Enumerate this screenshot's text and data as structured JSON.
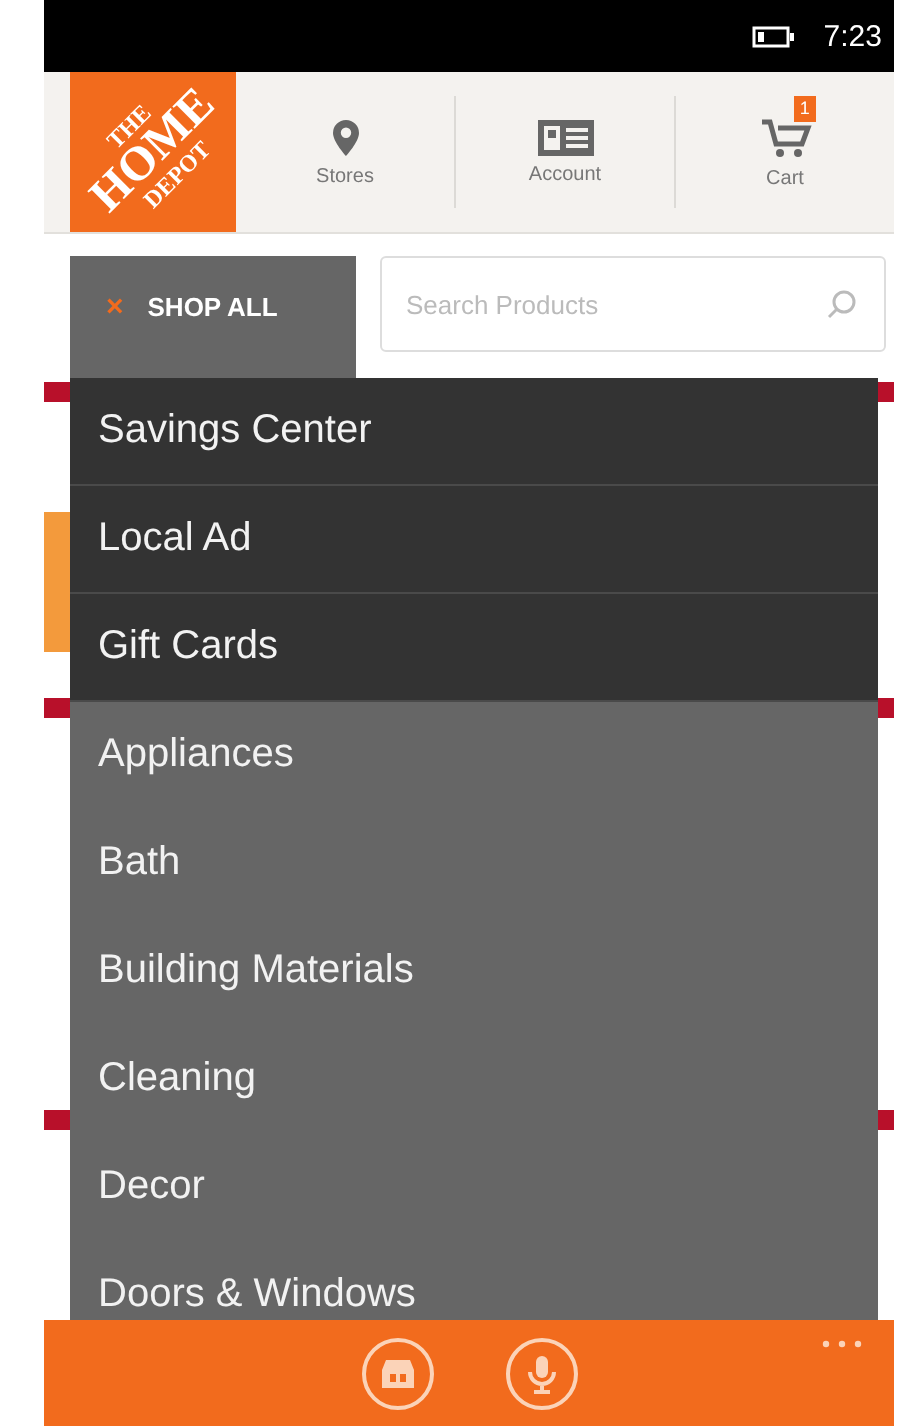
{
  "status_bar": {
    "time": "7:23"
  },
  "logo": [
    "THE",
    "HOME",
    "DEPOT"
  ],
  "nav": [
    {
      "kind": "stores",
      "label": "Stores"
    },
    {
      "kind": "account",
      "label": "Account"
    },
    {
      "kind": "cart",
      "label": "Cart",
      "badge": "1"
    }
  ],
  "shop_all": {
    "label": "SHOP ALL",
    "close": "×",
    "expanded": true
  },
  "search": {
    "placeholder": "Search Products"
  },
  "menu": [
    {
      "label": "Savings Center",
      "kind": "featured"
    },
    {
      "label": "Local Ad",
      "kind": "featured"
    },
    {
      "label": "Gift Cards",
      "kind": "featured"
    },
    {
      "label": "Appliances",
      "kind": "department"
    },
    {
      "label": "Bath",
      "kind": "department"
    },
    {
      "label": "Building Materials",
      "kind": "department"
    },
    {
      "label": "Cleaning",
      "kind": "department"
    },
    {
      "label": "Decor",
      "kind": "department"
    },
    {
      "label": "Doors & Windows",
      "kind": "department"
    }
  ],
  "app_bar": {
    "buttons": [
      {
        "kind": "store"
      },
      {
        "kind": "voice"
      }
    ]
  }
}
